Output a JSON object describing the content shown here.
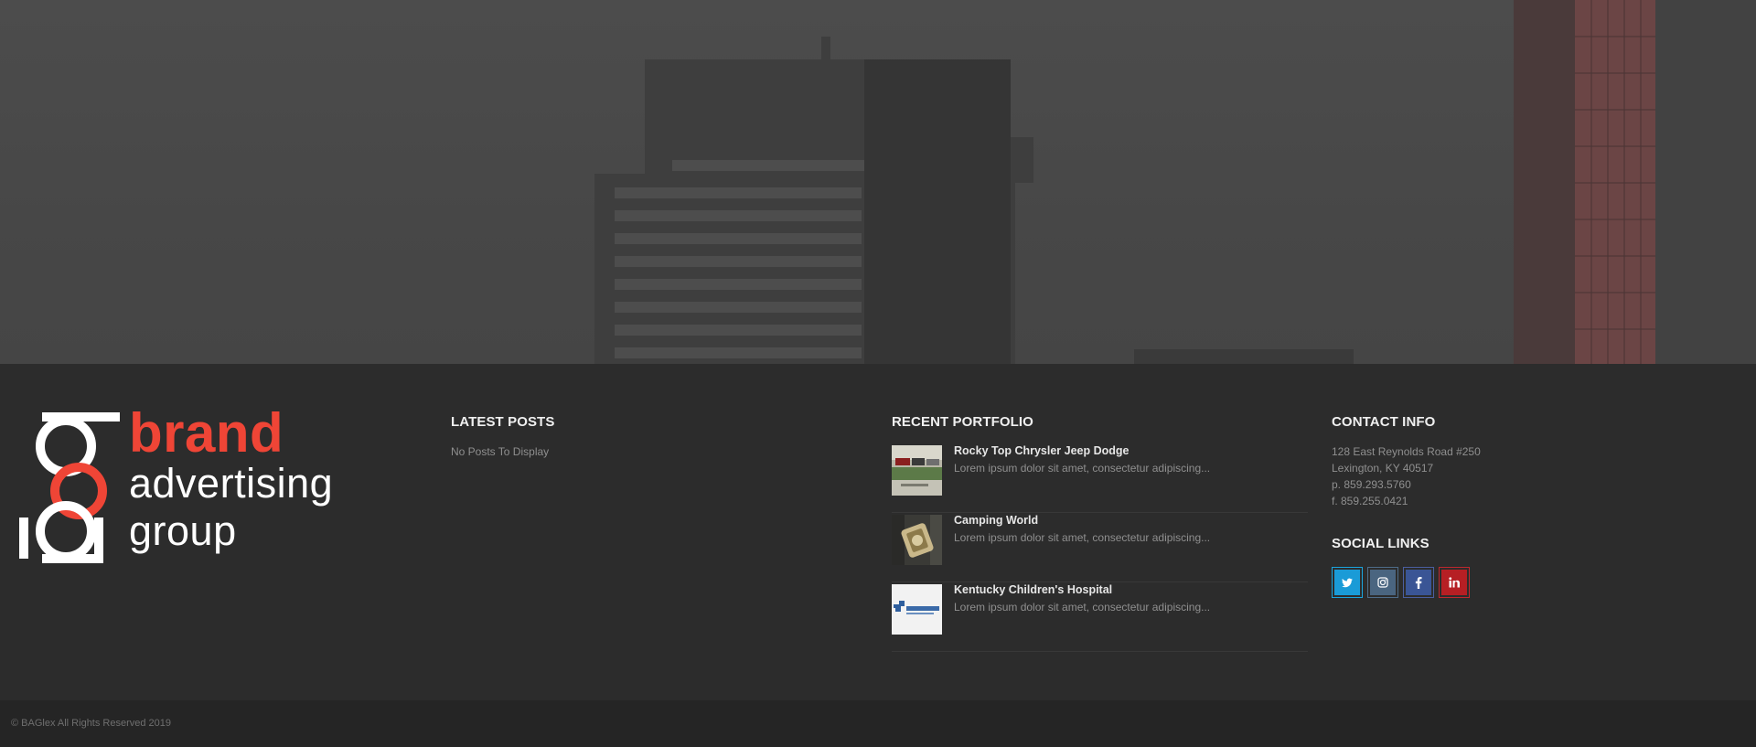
{
  "hero": {
    "image": "city-skyline-photo"
  },
  "logo": {
    "icon": "bag-monogram-icon",
    "brand": "brand",
    "line2": "advertising",
    "line3": "group",
    "colors": {
      "accent": "#ef4536",
      "white": "#ffffff"
    }
  },
  "latest_posts": {
    "title": "LATEST POSTS",
    "empty_text": "No Posts To Display"
  },
  "recent_portfolio": {
    "title": "RECENT PORTFOLIO",
    "items": [
      {
        "title": "Rocky Top Chrysler Jeep Dodge",
        "excerpt": "Lorem ipsum dolor sit amet, consectetur adipiscing...",
        "thumb": "dealership-thumbnail"
      },
      {
        "title": "Camping World",
        "excerpt": "Lorem ipsum dolor sit amet, consectetur adipiscing...",
        "thumb": "coin-thumbnail"
      },
      {
        "title": "Kentucky Children's Hospital",
        "excerpt": "Lorem ipsum dolor sit amet, consectetur adipiscing...",
        "thumb": "healthcare-logo-thumbnail"
      }
    ]
  },
  "contact": {
    "title": "CONTACT INFO",
    "address1": "128 East Reynolds Road #250",
    "address2": "Lexington, KY 40517",
    "phone": "p. 859.293.5760",
    "fax": "f. 859.255.0421"
  },
  "social": {
    "title": "SOCIAL LINKS",
    "links": [
      {
        "name": "twitter",
        "glyph": "t",
        "color": "#1a9bd7"
      },
      {
        "name": "instagram",
        "glyph": "◎",
        "color": "#4a6580"
      },
      {
        "name": "facebook",
        "glyph": "f",
        "color": "#3a5595"
      },
      {
        "name": "linkedin",
        "glyph": "in",
        "color": "#b61f24"
      }
    ]
  },
  "footer_bottom": {
    "copyright": "© BAGlex All Rights Reserved 2019"
  }
}
